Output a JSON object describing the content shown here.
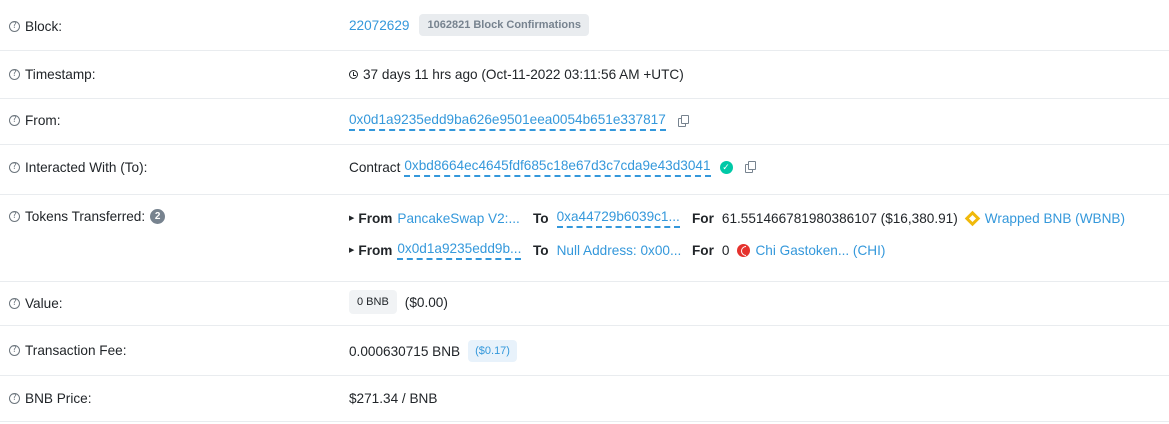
{
  "rows": {
    "block": {
      "label": "Block:",
      "number": "22072629",
      "confirmations": "1062821 Block Confirmations"
    },
    "timestamp": {
      "label": "Timestamp:",
      "value": "37 days 11 hrs ago (Oct-11-2022 03:11:56 AM +UTC)"
    },
    "from": {
      "label": "From:",
      "address": "0x0d1a9235edd9ba626e9501eea0054b651e337817"
    },
    "interacted": {
      "label": "Interacted With (To):",
      "prefix": "Contract",
      "address": "0xbd8664ec4645fdf685c18e67d3c7cda9e43d3041"
    },
    "tokens": {
      "label": "Tokens Transferred:",
      "count": "2",
      "transfers": [
        {
          "from_label": "From",
          "from": "PancakeSwap V2:...",
          "to_label": "To",
          "to": "0xa44729b6039c1...",
          "for_label": "For",
          "amount": "61.551466781980386107 ($16,380.91)",
          "token": "Wrapped BNB (WBNB)"
        },
        {
          "from_label": "From",
          "from": "0x0d1a9235edd9b...",
          "to_label": "To",
          "to": "Null Address: 0x00...",
          "for_label": "For",
          "amount": "0",
          "token": "Chi Gastoken... (CHI)"
        }
      ]
    },
    "value": {
      "label": "Value:",
      "amount": "0 BNB",
      "usd": "($0.00)"
    },
    "fee": {
      "label": "Transaction Fee:",
      "amount": "0.000630715 BNB",
      "usd": "($0.17)"
    },
    "price": {
      "label": "BNB Price:",
      "value": "$271.34 / BNB"
    }
  },
  "icons": {
    "help": "question-circle-icon",
    "clock": "clock-icon",
    "copy": "copy-icon",
    "verified": "check-circle-icon",
    "bnb": "bnb-token-icon",
    "chi": "chi-token-icon"
  },
  "colors": {
    "link": "#3498db",
    "verified": "#00c9a7",
    "badge_bg": "#e9ecef",
    "border": "#e9ecef"
  }
}
